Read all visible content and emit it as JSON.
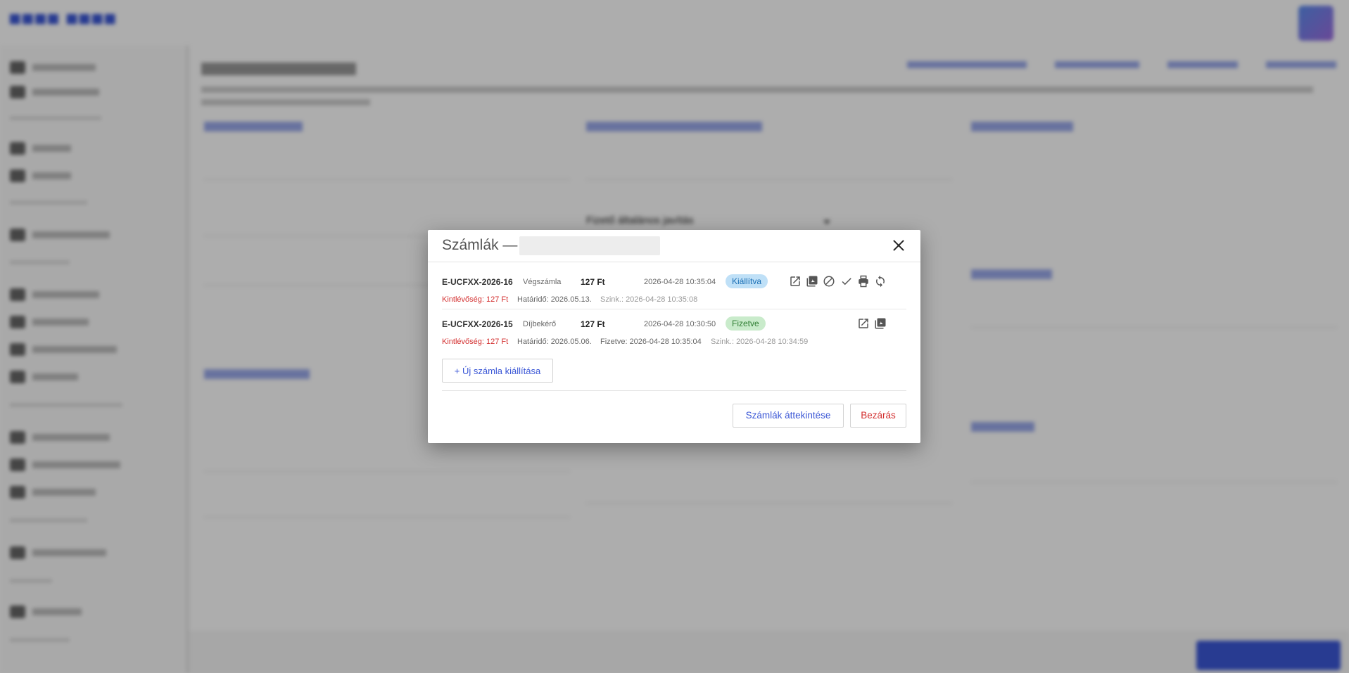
{
  "colors": {
    "accent": "#3b57d6",
    "danger": "#d32f2f",
    "badge_issued_bg": "#bfe0f7",
    "badge_paid_bg": "#c9ebcb",
    "overlay": "rgba(0,0,0,0.32)"
  },
  "background": {
    "select_value": "Fizető általános javítás"
  },
  "dialog": {
    "title": "Számlák —",
    "invoices": [
      {
        "id": "E-UCFXX-2026-16",
        "type": "Végszámla",
        "amount": "127 Ft",
        "date": "2026-04-28 10:35:04",
        "status": "Kiállítva",
        "outstanding": "Kintlévőség: 127 Ft",
        "due": "Határidő: 2026.05.13.",
        "sync": "Szink.: 2026-04-28 10:35:08",
        "actions": [
          "open-external-icon",
          "pdf-icon",
          "cancel-icon",
          "check-icon",
          "print-icon",
          "sync-icon"
        ]
      },
      {
        "id": "E-UCFXX-2026-15",
        "type": "Díjbekérő",
        "amount": "127 Ft",
        "date": "2026-04-28 10:30:50",
        "status": "Fizetve",
        "outstanding": "Kintlévőség: 127 Ft",
        "due": "Határidő: 2026.05.06.",
        "paid": "Fizetve: 2026-04-28 10:35:04",
        "sync": "Szink.: 2026-04-28 10:34:59",
        "actions": [
          "open-external-icon",
          "pdf-icon"
        ]
      }
    ],
    "new_invoice_label": "+ Új számla kiállítása",
    "review_label": "Számlák áttekintése",
    "close_label": "Bezárás"
  }
}
